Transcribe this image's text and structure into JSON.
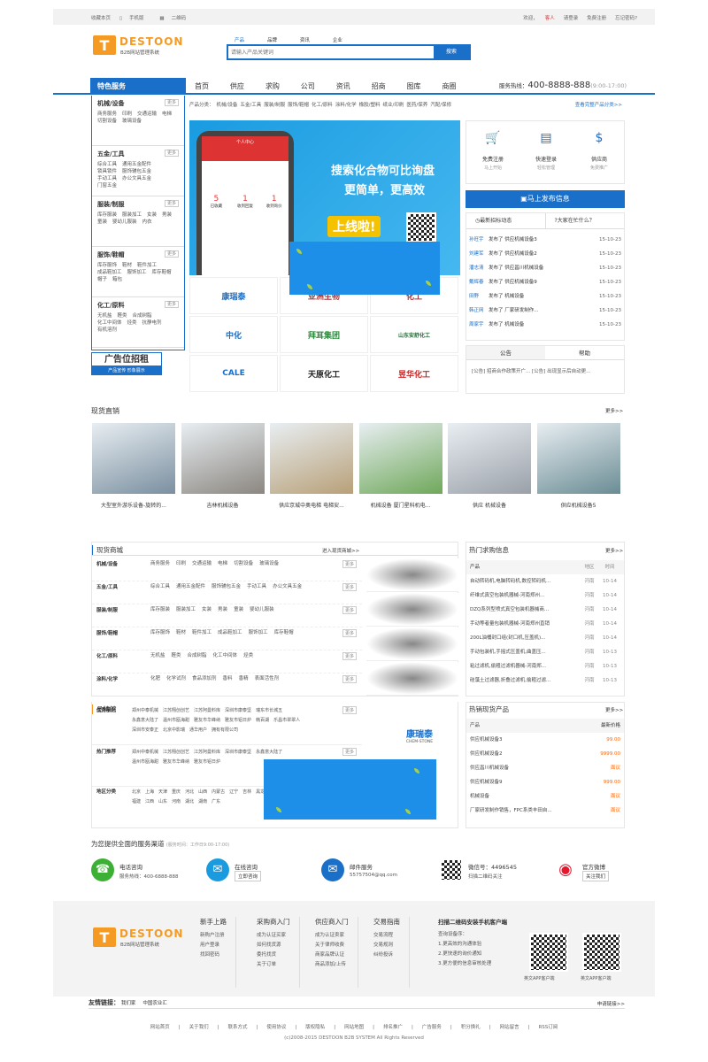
{
  "topbar": {
    "fav": "收藏本页",
    "mobile": "手机版",
    "qrcode": "二维码",
    "welcome": "欢迎，",
    "guest": "客人",
    "login": "请登录",
    "register": "免费注册",
    "forgot": "忘记密码?"
  },
  "logo": {
    "letter": "T",
    "name": "DESTOON",
    "sub": "B2B网站管理系统"
  },
  "search": {
    "tabs": [
      "产品",
      "品牌",
      "资讯",
      "企业"
    ],
    "placeholder": "请输入产品关键词",
    "button": "搜索"
  },
  "nav": {
    "category": "特色服务",
    "items": [
      "首页",
      "供应",
      "求购",
      "公司",
      "资讯",
      "招商",
      "图库",
      "商圈"
    ],
    "hotline_label": "服务热线：",
    "hotline": "400-8888-888",
    "hours": "(9:00-17:00)"
  },
  "categories": [
    {
      "title": "机械/设备",
      "items": [
        "商务服务",
        "印刷",
        "交通运输",
        "电梯",
        "切割设备",
        "玻璃设备"
      ]
    },
    {
      "title": "五金/工具",
      "items": [
        "综合工具",
        "通用五金配件",
        "锁具锁件",
        "服饰辅包五金",
        "手动工具",
        "办公文具五金",
        "门窗五金"
      ]
    },
    {
      "title": "服装/制服",
      "items": [
        "库存服装",
        "服装加工",
        "女装",
        "男装",
        "童装",
        "婴幼儿服装",
        "内衣"
      ]
    },
    {
      "title": "服饰/鞋帽",
      "items": [
        "库存服饰",
        "鞋材",
        "鞋件加工",
        "成品鞋加工",
        "服饰加工",
        "库存鞋帽",
        "帽子",
        "箱包"
      ]
    },
    {
      "title": "化工/原料",
      "items": [
        "无机盐",
        "醛类",
        "合成树脂",
        "化工中间体",
        "烃类",
        "抗静电剂",
        "有机溶剂"
      ]
    }
  ],
  "more": "更多",
  "ad": {
    "title": "广告位招租",
    "sub": "产品宣传 形象展示"
  },
  "ptypes": {
    "label": "产品分类：",
    "items": [
      "机械/设备",
      "五金/工具",
      "服装/制服",
      "服饰/鞋帽",
      "化工/原料",
      "涂料/化学",
      "橡胶/塑料",
      "纸业/印刷",
      "医药/保养",
      "汽配/保修"
    ],
    "link": "查看完整产品分类>>"
  },
  "banner": {
    "line1": "搜索化合物可比询盘",
    "line2": "更简单，更高效",
    "tag": "上线啦!",
    "phone_title": "个人中心",
    "phone_nums": [
      "5",
      "1",
      "1"
    ],
    "phone_labels": [
      "已收藏",
      "收到回复",
      "收到询价"
    ],
    "qr_label": "扫描二维码 下载客户端"
  },
  "brands": [
    "康瑞泰",
    "亚洲生物",
    "化工",
    "中化",
    "拜耳集团",
    "山东安舒化工",
    "CALE",
    "天原化工",
    "昱华化工"
  ],
  "services": [
    {
      "title": "免费注册",
      "desc": "马上开始"
    },
    {
      "title": "快速登录",
      "desc": "轻松管理"
    },
    {
      "title": "供应商",
      "desc": "免费推广"
    }
  ],
  "publish": "马上发布信息",
  "news": {
    "tab1": "最新招标动态",
    "tab2": "大家在忙什么？",
    "rows": [
      {
        "user": "孙旺宇",
        "text": "发布了 供应机械设备3",
        "date": "15-10-23"
      },
      {
        "user": "刘建军",
        "text": "发布了 供应机械设备2",
        "date": "15-10-23"
      },
      {
        "user": "潘志清",
        "text": "发布了 供应昌川机械设备",
        "date": "15-10-23"
      },
      {
        "user": "戴辉春",
        "text": "发布了 供应机械设备9",
        "date": "15-10-23"
      },
      {
        "user": "田野",
        "text": "发布了 机械设备",
        "date": "15-10-23"
      },
      {
        "user": "韩正网",
        "text": "发布了 厂家研发制作...",
        "date": "15-10-23"
      },
      {
        "user": "周家宇",
        "text": "发布了 机械设备",
        "date": "15-10-23"
      }
    ]
  },
  "notice": {
    "tab1": "公告",
    "tab2": "帮助",
    "text": "[公告] 招商合作政策开广...  [公告] 出现显示后自动更..."
  },
  "spot": {
    "title": "现货直销",
    "more": "更多>>",
    "items": [
      "大型室外游乐设备-旋转的...",
      "吉林机械设备",
      "供应京城中奥电梯 电梯安...",
      "机械设备 厦门星科机电...",
      "供应 机械设备",
      "供应机械设备5"
    ]
  },
  "mall": {
    "title": "现货商城",
    "more": "进入现货商城>>",
    "rows": [
      {
        "name": "机械/设备",
        "items": [
          "商务服务",
          "印刷",
          "交通运输",
          "电梯",
          "切割设备",
          "玻璃设备"
        ]
      },
      {
        "name": "五金/工具",
        "items": [
          "综合工具",
          "通用五金配件",
          "服饰辅包五金",
          "手动工具",
          "办公文具五金"
        ]
      },
      {
        "name": "服装/制服",
        "items": [
          "库存服装",
          "服装加工",
          "女装",
          "男装",
          "童装",
          "婴幼儿服装"
        ]
      },
      {
        "name": "服饰/鞋帽",
        "items": [
          "库存服饰",
          "鞋材",
          "鞋件加工",
          "成品鞋加工",
          "服饰加工",
          "库存鞋帽"
        ]
      },
      {
        "name": "化工/原料",
        "items": [
          "无机盐",
          "醛类",
          "合成树脂",
          "化工中间体",
          "烃类"
        ]
      },
      {
        "name": "涂料/化学",
        "items": [
          "化肥",
          "化学试剂",
          "食品添加剂",
          "香料",
          "香精",
          "表面活性剂"
        ]
      }
    ]
  },
  "buy": {
    "title": "热门求购信息",
    "more": "更多>>",
    "headers": [
      "产品",
      "地区",
      "时间"
    ],
    "rows": [
      {
        "p": "自动转码机,电脑转码机,数控转码机...",
        "r": "河南",
        "t": "10-14"
      },
      {
        "p": "纤维式真空包装机器械-河南郑州...",
        "r": "河南",
        "t": "10-14"
      },
      {
        "p": "DZQ系列型喷式真空包装机器械商...",
        "r": "河南",
        "t": "10-14"
      },
      {
        "p": "手动等者量包装机器械-河南郑州直销",
        "r": "河南",
        "t": "10-14"
      },
      {
        "p": "200L油桶封口组(封口机,压盖机)...",
        "r": "河南",
        "t": "10-14"
      },
      {
        "p": "手动包装机,手摇式压盖机,曲盖压...",
        "r": "河南",
        "t": "10-13"
      },
      {
        "p": "粘过滤机,偷粗过滤机器械-河南郑...",
        "r": "河南",
        "t": "10-13"
      },
      {
        "p": "硅藻土过滤器,折叠过滤机,偷粗过滤...",
        "r": "河南",
        "t": "10-13"
      }
    ]
  },
  "brandhall": {
    "title": "品牌馆",
    "more": "更多>>",
    "rows": [
      {
        "name": "优秀服务",
        "items": [
          "郑州中泰机械",
          "江苏翔创创艺",
          "江苏阿曼料库",
          "深圳市康泰坚",
          "瑞东市长城五",
          "永鑫意大陆了",
          "温州市瓯海甜",
          "雅友市华峰纳",
          "雅友市铝日炉",
          "韩百湖",
          "乐昌市翠翠人",
          "深圳市安泰正",
          "北京中影瑞",
          "通华用户",
          "拥有有限公司"
        ]
      },
      {
        "name": "热门推荐",
        "items": [
          "郑州中泰机械",
          "江苏翔创创艺",
          "江苏阿曼料库",
          "深圳市康泰坚",
          "永鑫意大陆了",
          "温州市瓯海甜",
          "雅友市华峰纳",
          "雅友市铝日炉"
        ]
      },
      {
        "name": "地区分类",
        "items": [
          "北京",
          "上海",
          "天津",
          "重庆",
          "河北",
          "山西",
          "内蒙古",
          "辽宁",
          "吉林",
          "黑龙江",
          "江苏",
          "安徽",
          "福建",
          "江西",
          "山东",
          "河南",
          "湖北",
          "湖南",
          "广东"
        ]
      }
    ],
    "logo": "康瑞泰",
    "logo_sub": "CHEM-STONE"
  },
  "hotp": {
    "title": "热销现货产品",
    "more": "更多>>",
    "headers": [
      "产品",
      "最新价格"
    ],
    "rows": [
      {
        "p": "供应机械设备3",
        "price": "99.00"
      },
      {
        "p": "供应机械设备2",
        "price": "9999.00"
      },
      {
        "p": "供应昌川机械设备",
        "price": "面议"
      },
      {
        "p": "供应机械设备9",
        "price": "999.00"
      },
      {
        "p": "机械设备",
        "price": "面议"
      },
      {
        "p": "厂家研发制作销售，FPC系类丰田自...",
        "price": "面议"
      }
    ]
  },
  "channels": {
    "title": "为您提供全面的服务渠道",
    "note": "(服务时间：工作日9:00-17:00)",
    "items": [
      {
        "title": "电话咨询",
        "desc": "服务热线：400-6888-888",
        "icon": "☎",
        "color": "#3cb034"
      },
      {
        "title": "在线咨询",
        "desc": "立即咨询",
        "icon": "✉",
        "color": "#1a9be0"
      },
      {
        "title": "邮件服务",
        "desc": "55757504@qq.com",
        "icon": "✉",
        "color": "#1a6fc9"
      },
      {
        "title": "微信号：4496545",
        "desc": "扫描二维码关注",
        "icon": "",
        "color": "#222"
      },
      {
        "title": "官方微博",
        "desc": "关注我们",
        "icon": "◉",
        "color": "#e6162d"
      }
    ]
  },
  "footer": {
    "cols": [
      {
        "title": "新手上路",
        "links": [
          "新购户注册",
          "用户登录",
          "找回密码"
        ]
      },
      {
        "title": "采购商入门",
        "links": [
          "成为认证买家",
          "如何找货源",
          "委托找货",
          "关于订单"
        ]
      },
      {
        "title": "供应商入门",
        "links": [
          "成为认证卖家",
          "关于律师收费",
          "商家品牌认证",
          "商品添加/上传"
        ]
      },
      {
        "title": "交易指南",
        "links": [
          "交易流程",
          "交易规则",
          "纠纷投诉"
        ]
      },
      {
        "title": "扫描二维码安装手机客户端",
        "links": [
          "查询设备序：",
          "1.更高效的沟通体验",
          "2.更快速的询价通知",
          "3.更方便的信息审核处理"
        ]
      }
    ],
    "qr1": "中文APP客户端",
    "qr2": "英文APP客户端"
  },
  "friend": {
    "title": "友情链接：",
    "links": [
      "我们家",
      "中国农业汇"
    ],
    "apply": "申请链接>>"
  },
  "bottom_links": [
    "网站首页",
    "关于我们",
    "联系方式",
    "使用协议",
    "版权隐私",
    "网站地图",
    "排名推广",
    "广告服务",
    "积分换礼",
    "网站留言",
    "RSS订阅"
  ],
  "copyright": "(c)2008-2015 DESTOON B2B SYSTEM All Rights Reserved"
}
